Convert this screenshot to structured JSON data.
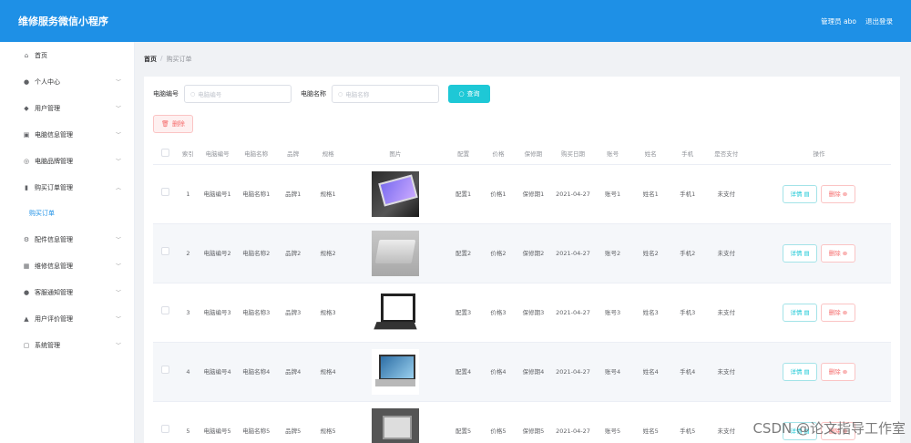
{
  "header": {
    "title": "维修服务微信小程序",
    "admin_label": "管理员 abo",
    "logout_label": "退出登录"
  },
  "sidebar": {
    "items": [
      {
        "icon": "home-icon",
        "glyph": "⌂",
        "label": "首页",
        "has_chevron": false
      },
      {
        "icon": "user-icon",
        "glyph": "●",
        "label": "个人中心",
        "has_chevron": true
      },
      {
        "icon": "users-icon",
        "glyph": "◆",
        "label": "用户管理",
        "has_chevron": true
      },
      {
        "icon": "computer-icon",
        "glyph": "▣",
        "label": "电脑信息管理",
        "has_chevron": true
      },
      {
        "icon": "brand-icon",
        "glyph": "◎",
        "label": "电脑品牌管理",
        "has_chevron": true
      },
      {
        "icon": "chart-icon",
        "glyph": "▮",
        "label": "购买订单管理",
        "has_chevron": true,
        "expanded": true
      }
    ],
    "sub_item": "购买订单",
    "items_after": [
      {
        "icon": "parts-icon",
        "glyph": "⚙",
        "label": "配件信息管理",
        "has_chevron": true
      },
      {
        "icon": "repair-icon",
        "glyph": "▦",
        "label": "维修信息管理",
        "has_chevron": true
      },
      {
        "icon": "notice-icon",
        "glyph": "●",
        "label": "客服通知管理",
        "has_chevron": true
      },
      {
        "icon": "review-icon",
        "glyph": "▲",
        "label": "用户评价管理",
        "has_chevron": true
      },
      {
        "icon": "system-icon",
        "glyph": "▢",
        "label": "系统管理",
        "has_chevron": true
      }
    ]
  },
  "breadcrumb": {
    "home": "首页",
    "sep": "/",
    "current": "购买订单"
  },
  "search": {
    "field1_label": "电脑编号",
    "field1_placeholder": "电脑编号",
    "field2_label": "电脑名称",
    "field2_placeholder": "电脑名称",
    "query_label": "查询"
  },
  "delete_label": "删除",
  "table": {
    "headers": [
      "",
      "索引",
      "电脑编号",
      "电脑名称",
      "品牌",
      "规格",
      "图片",
      "配置",
      "价格",
      "保修期",
      "购买日期",
      "账号",
      "姓名",
      "手机",
      "是否支付",
      "操作"
    ],
    "detail_label": "详情",
    "delete_label": "删除",
    "rows": [
      {
        "index": "1",
        "code": "电脑编号1",
        "name": "电脑名称1",
        "brand": "品牌1",
        "spec": "规格1",
        "config": "配置1",
        "price": "价格1",
        "warranty": "保修期1",
        "date": "2021-04-27",
        "account": "账号1",
        "person": "姓名1",
        "phone": "手机1",
        "paid": "未支付"
      },
      {
        "index": "2",
        "code": "电脑编号2",
        "name": "电脑名称2",
        "brand": "品牌2",
        "spec": "规格2",
        "config": "配置2",
        "price": "价格2",
        "warranty": "保修期2",
        "date": "2021-04-27",
        "account": "账号2",
        "person": "姓名2",
        "phone": "手机2",
        "paid": "未支付"
      },
      {
        "index": "3",
        "code": "电脑编号3",
        "name": "电脑名称3",
        "brand": "品牌3",
        "spec": "规格3",
        "config": "配置3",
        "price": "价格3",
        "warranty": "保修期3",
        "date": "2021-04-27",
        "account": "账号3",
        "person": "姓名3",
        "phone": "手机3",
        "paid": "未支付"
      },
      {
        "index": "4",
        "code": "电脑编号4",
        "name": "电脑名称4",
        "brand": "品牌4",
        "spec": "规格4",
        "config": "配置4",
        "price": "价格4",
        "warranty": "保修期4",
        "date": "2021-04-27",
        "account": "账号4",
        "person": "姓名4",
        "phone": "手机4",
        "paid": "未支付"
      },
      {
        "index": "5",
        "code": "电脑编号5",
        "name": "电脑名称5",
        "brand": "品牌5",
        "spec": "规格5",
        "config": "配置5",
        "price": "价格5",
        "warranty": "保修期5",
        "date": "2021-04-27",
        "account": "账号5",
        "person": "姓名5",
        "phone": "手机5",
        "paid": "未支付"
      }
    ]
  },
  "watermark": "CSDN @论文指导工作室",
  "colors": {
    "header": "#1e90e6",
    "query_button": "#1ec8d6",
    "danger": "#f56c6c"
  }
}
